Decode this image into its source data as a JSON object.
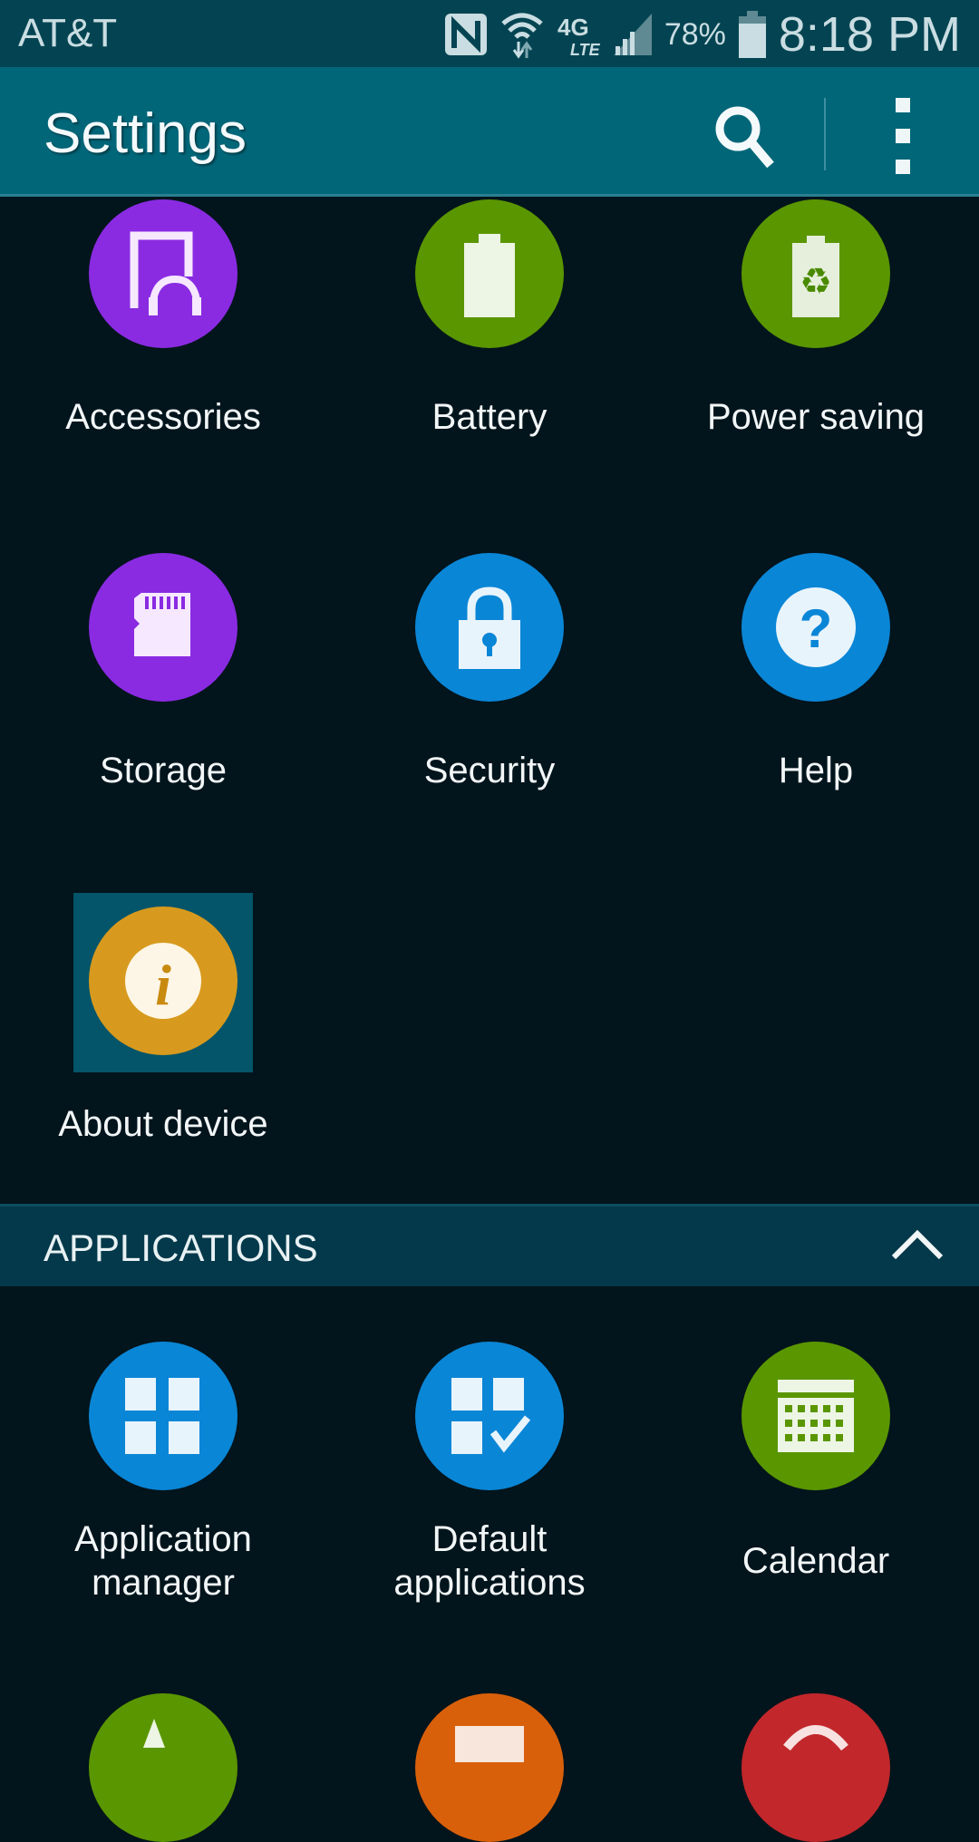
{
  "status_bar": {
    "carrier": "AT&T",
    "icons": [
      "nfc-icon",
      "wifi-icon",
      "4g-lte-icon",
      "signal-icon",
      "battery-icon"
    ],
    "network": "4G LTE",
    "battery_percent": "78%",
    "time": "8:18 PM"
  },
  "app_bar": {
    "title": "Settings",
    "actions": [
      "search-icon",
      "more-vert-icon"
    ]
  },
  "colors": {
    "status_bar": "#044452",
    "app_bar": "#026679",
    "background": "#02141c",
    "section_header": "#03394a",
    "purple": "#8a2be2",
    "green": "#5a9600",
    "blue": "#0a86d6",
    "gold": "#d89a1e",
    "orange": "#d9600a",
    "red": "#c2272b"
  },
  "device_items": [
    {
      "label": "Accessories",
      "icon": "accessories-icon"
    },
    {
      "label": "Battery",
      "icon": "battery-icon"
    },
    {
      "label": "Power saving",
      "icon": "power-saving-icon"
    },
    {
      "label": "Storage",
      "icon": "sd-card-icon"
    },
    {
      "label": "Security",
      "icon": "lock-icon"
    },
    {
      "label": "Help",
      "icon": "help-icon"
    },
    {
      "label": "About device",
      "icon": "info-icon",
      "selected": true
    }
  ],
  "applications_section": {
    "title": "APPLICATIONS",
    "expanded": true,
    "items": [
      {
        "label_line1": "Application",
        "label_line2": "manager",
        "icon": "app-grid-icon"
      },
      {
        "label_line1": "Default",
        "label_line2": "applications",
        "icon": "default-apps-icon"
      },
      {
        "label": "Calendar",
        "icon": "calendar-icon"
      }
    ]
  }
}
